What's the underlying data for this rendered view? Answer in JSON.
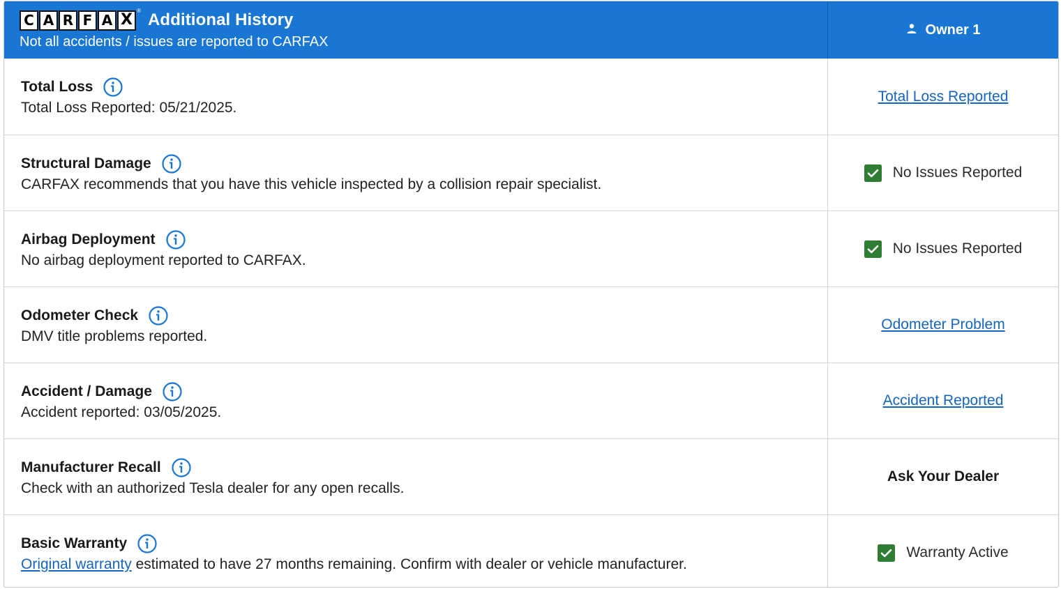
{
  "header": {
    "logo_letters": [
      "C",
      "A",
      "R",
      "F",
      "A",
      "X"
    ],
    "logo_reg": "®",
    "title": "Additional History",
    "subtitle": "Not all accidents / issues are reported to CARFAX",
    "owner_label": "Owner 1"
  },
  "colors": {
    "header_bg": "#1976d2",
    "link": "#1565c0",
    "check_green": "#2e7d32"
  },
  "rows": [
    {
      "title": "Total Loss",
      "description": "Total Loss Reported: 05/21/2025.",
      "status": {
        "type": "link",
        "text": "Total Loss Reported"
      }
    },
    {
      "title": "Structural Damage",
      "description": "CARFAX recommends that you have this vehicle inspected by a collision repair specialist.",
      "status": {
        "type": "check",
        "text": "No Issues Reported",
        "icon": "check-icon"
      }
    },
    {
      "title": "Airbag Deployment",
      "description": "No airbag deployment reported to CARFAX.",
      "status": {
        "type": "check",
        "text": "No Issues Reported",
        "icon": "check-icon"
      }
    },
    {
      "title": "Odometer Check",
      "description": "DMV title problems reported.",
      "status": {
        "type": "link",
        "text": "Odometer Problem"
      }
    },
    {
      "title": "Accident / Damage",
      "description": "Accident reported: 03/05/2025.",
      "status": {
        "type": "link",
        "text": "Accident Reported"
      }
    },
    {
      "title": "Manufacturer Recall",
      "description": "Check with an authorized Tesla dealer for any open recalls.",
      "status": {
        "type": "bold",
        "text": "Ask Your Dealer"
      }
    },
    {
      "title": "Basic Warranty",
      "description_link": "Original warranty",
      "description": " estimated to have 27 months remaining. Confirm with dealer or vehicle manufacturer.",
      "status": {
        "type": "check",
        "text": "Warranty Active",
        "icon": "check-icon"
      }
    }
  ]
}
